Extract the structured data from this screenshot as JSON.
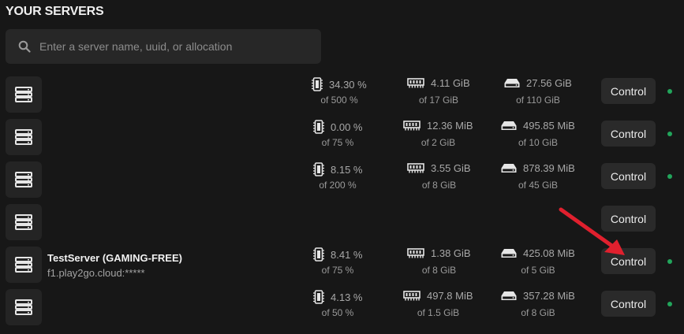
{
  "page": {
    "title": "YOUR SERVERS"
  },
  "search": {
    "placeholder": "Enter a server name, uuid, or allocation",
    "value": ""
  },
  "servers": [
    {
      "name": "",
      "address": "",
      "cpu": "34.30 %",
      "cpu_limit": "of 500 %",
      "memory": "4.11 GiB",
      "memory_limit": "of 17 GiB",
      "disk": "27.56 GiB",
      "disk_limit": "of 110 GiB",
      "control_label": "Control",
      "online": true
    },
    {
      "name": "",
      "address": "",
      "cpu": "0.00 %",
      "cpu_limit": "of 75 %",
      "memory": "12.36 MiB",
      "memory_limit": "of 2 GiB",
      "disk": "495.85 MiB",
      "disk_limit": "of 10 GiB",
      "control_label": "Control",
      "online": true
    },
    {
      "name": "",
      "address": "",
      "cpu": "8.15 %",
      "cpu_limit": "of 200 %",
      "memory": "3.55 GiB",
      "memory_limit": "of 8 GiB",
      "disk": "878.39 MiB",
      "disk_limit": "of 45 GiB",
      "control_label": "Control",
      "online": true
    },
    {
      "name": "",
      "address": "",
      "cpu": "",
      "cpu_limit": "",
      "memory": "",
      "memory_limit": "",
      "disk": "",
      "disk_limit": "",
      "control_label": "Control",
      "online": false
    },
    {
      "name": "TestServer (GAMING-FREE)",
      "address": "f1.play2go.cloud:*****",
      "cpu": "8.41 %",
      "cpu_limit": "of 75 %",
      "memory": "1.38 GiB",
      "memory_limit": "of 8 GiB",
      "disk": "425.08 MiB",
      "disk_limit": "of 5 GiB",
      "control_label": "Control",
      "online": true
    },
    {
      "name": "",
      "address": "",
      "cpu": "4.13 %",
      "cpu_limit": "of 50 %",
      "memory": "497.8 MiB",
      "memory_limit": "of 1.5 GiB",
      "disk": "357.28 MiB",
      "disk_limit": "of 8 GiB",
      "control_label": "Control",
      "online": true
    }
  ],
  "icons": {
    "search": "search-icon",
    "server": "server-icon",
    "cpu": "cpu-icon",
    "memory": "memory-icon",
    "disk": "disk-icon"
  },
  "colors": {
    "background": "#171717",
    "card": "#242424",
    "button": "#2a2a2a",
    "online": "#22a55b",
    "annotation_arrow": "#e0202e"
  }
}
